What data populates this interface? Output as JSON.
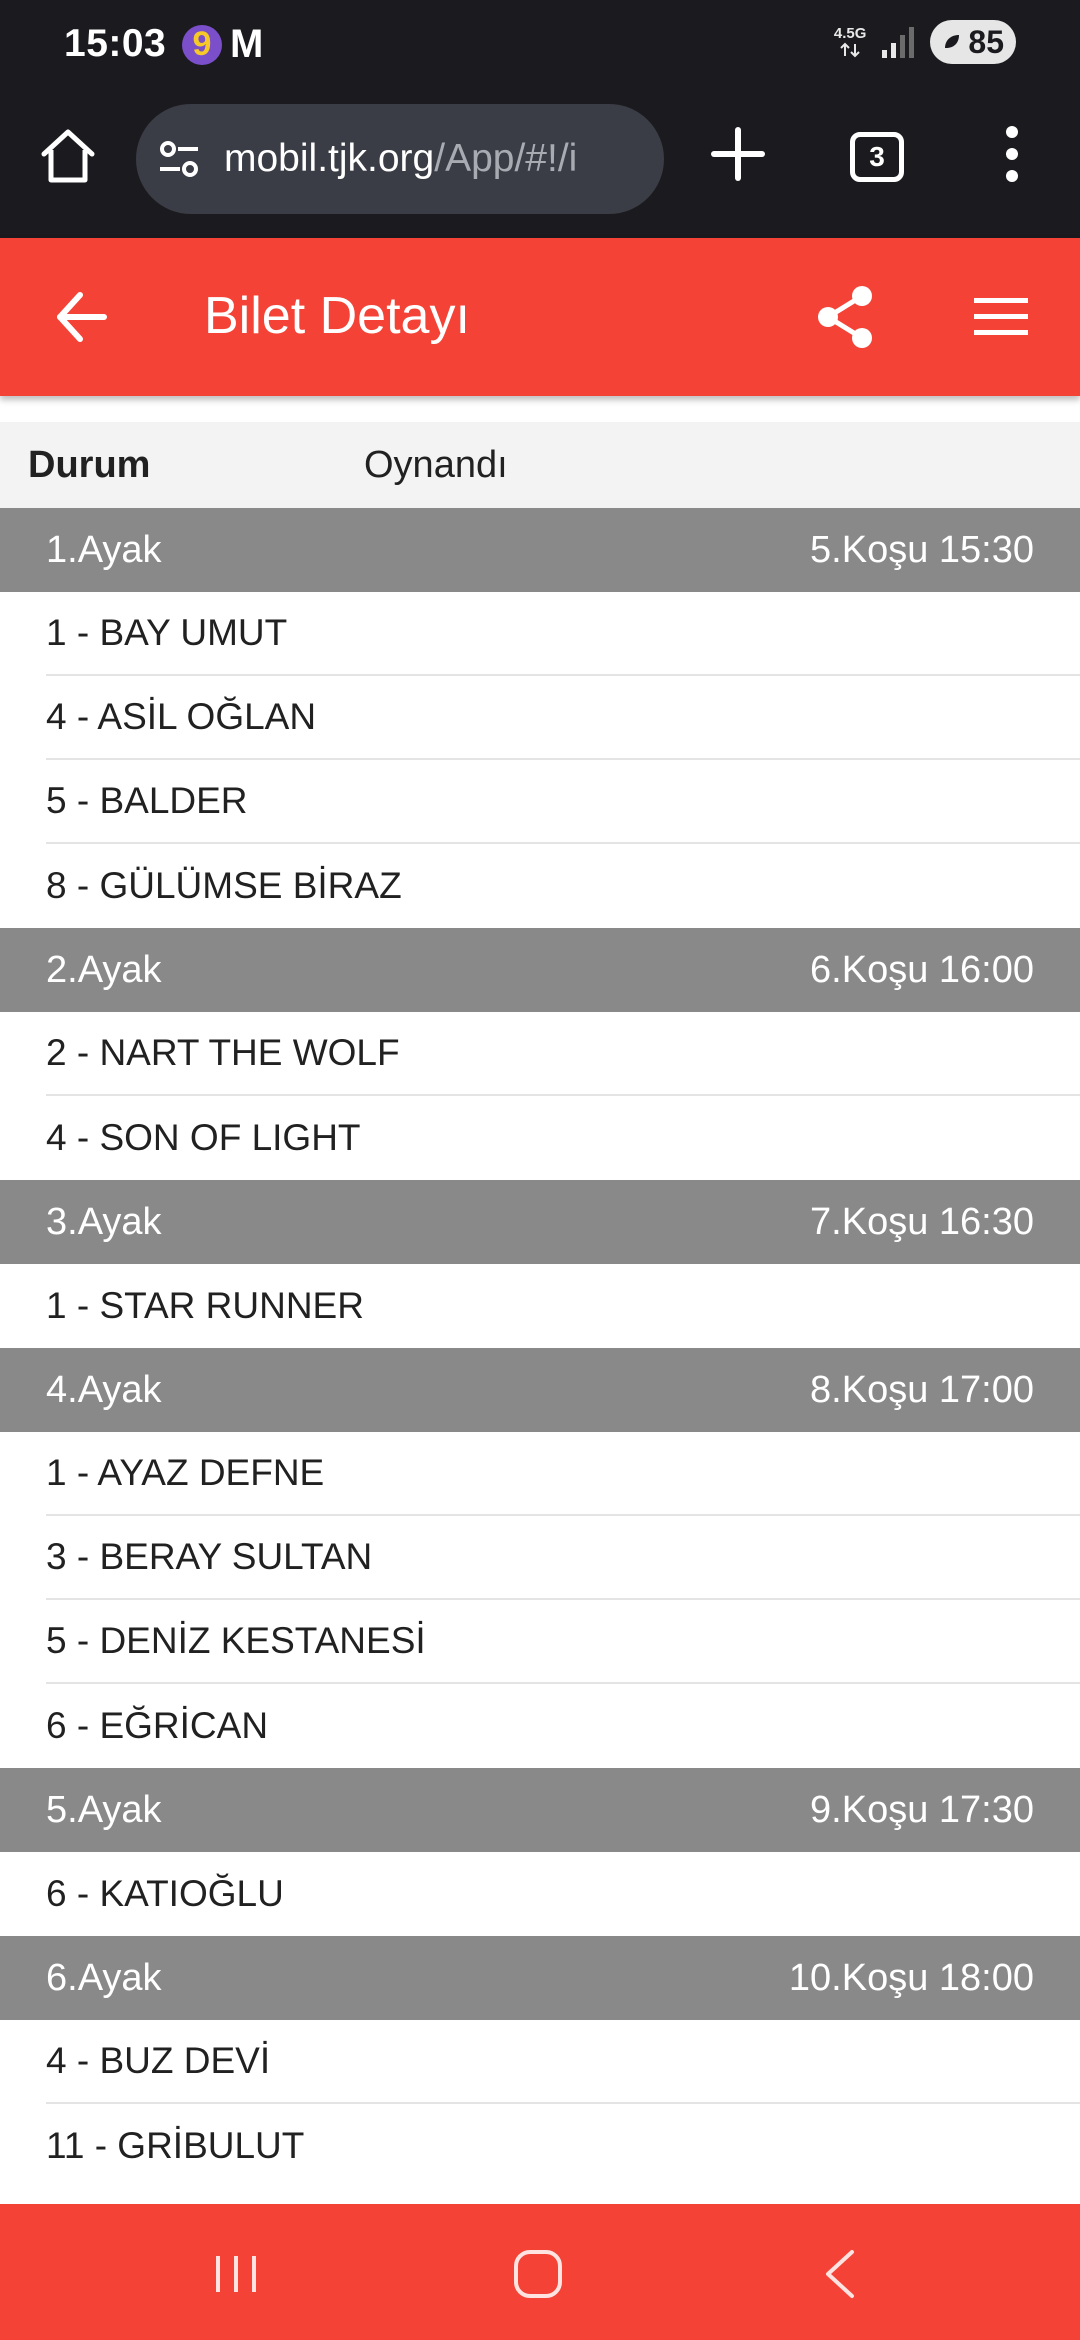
{
  "status_bar": {
    "time": "15:03",
    "app_icons": [
      "9",
      "M"
    ],
    "network": "4.5G",
    "battery": "85"
  },
  "browser": {
    "url_host": "mobil.tjk.org",
    "url_path": "/App/#!/i",
    "tab_count": "3"
  },
  "header": {
    "title": "Bilet Detayı"
  },
  "status": {
    "label": "Durum",
    "value": "Oynandı"
  },
  "legs": [
    {
      "name": "1.Ayak",
      "race": "5.Koşu 15:30",
      "horses": [
        "1 - BAY UMUT",
        "4 - ASİL OĞLAN",
        "5 - BALDER",
        "8 - GÜLÜMSE BİRAZ"
      ]
    },
    {
      "name": "2.Ayak",
      "race": "6.Koşu 16:00",
      "horses": [
        "2 - NART THE WOLF",
        "4 - SON OF LIGHT"
      ]
    },
    {
      "name": "3.Ayak",
      "race": "7.Koşu 16:30",
      "horses": [
        "1 - STAR RUNNER"
      ]
    },
    {
      "name": "4.Ayak",
      "race": "8.Koşu 17:00",
      "horses": [
        "1 - AYAZ DEFNE",
        "3 - BERAY SULTAN",
        "5 - DENİZ KESTANESİ",
        "6 - EĞRİCAN"
      ]
    },
    {
      "name": "5.Ayak",
      "race": "9.Koşu 17:30",
      "horses": [
        "6 - KATIOĞLU"
      ]
    },
    {
      "name": "6.Ayak",
      "race": "10.Koşu 18:00",
      "horses": [
        "4 - BUZ DEVİ",
        "11 - GRİBULUT"
      ]
    }
  ],
  "colors": {
    "accent": "#f44336",
    "leg_header": "#898989",
    "browser_bg": "#1b1b1f"
  }
}
